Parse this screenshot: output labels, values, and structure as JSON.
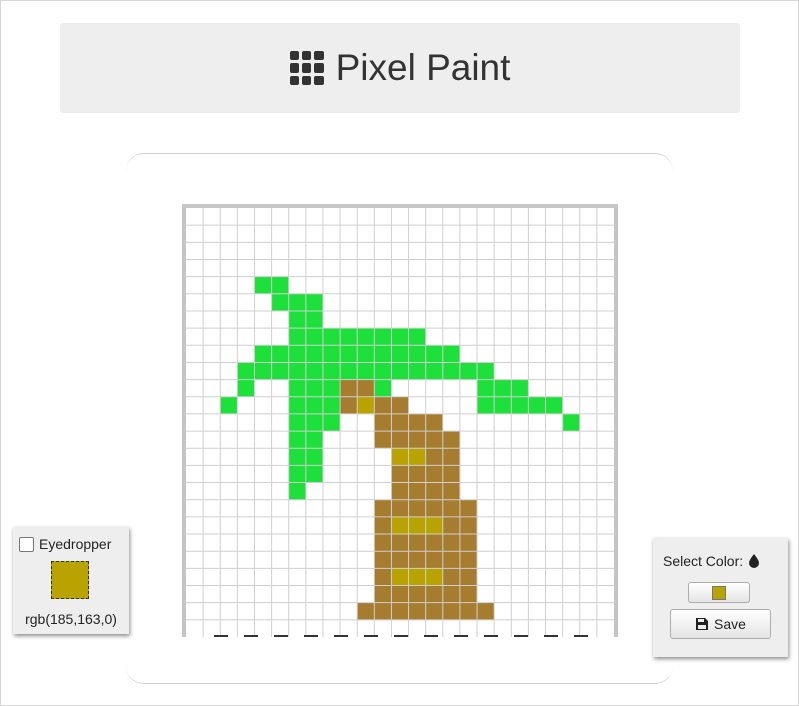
{
  "header": {
    "title": "Pixel Paint",
    "icon": "grid-icon"
  },
  "canvas": {
    "columns": 25,
    "rows": 25,
    "grid_line_color": "#cfcfcf",
    "palette": {
      "g": "#1ee03b",
      "b": "#a67c2e",
      "y": "#b9a300"
    },
    "pixels": [
      ".........................",
      ".........................",
      ".........................",
      ".........................",
      "....gg...................",
      ".....ggg.................",
      "......gg.................",
      "......gggggggg...........",
      "....gggggggggggg.........",
      "...ggggggggggggggg.......",
      "...g..gggbbg.....ggg.....",
      "..g...gggbybb....ggggg...",
      "......ggg..bbbb.......g..",
      "......gg...bbbbb.........",
      "......gg....yybb.........",
      "......gg....bbbb.........",
      "......g.....bbbb.........",
      "...........bbbbbb........",
      "...........byyybb........",
      "...........bbbbbb........",
      "...........bbbbbb........",
      "...........byyybb........",
      "...........bbbbbb........",
      "..........bbbbbbbb.......",
      "........................."
    ]
  },
  "eyedropper": {
    "label": "Eyedropper",
    "checked": false,
    "current_color": "#b9a300",
    "rgb_text": "rgb(185,163,0)"
  },
  "color_picker": {
    "label": "Select Color:",
    "label_icon": "drop-icon",
    "selected_color": "#b9a300",
    "save_label": "Save",
    "save_icon": "save-icon"
  }
}
